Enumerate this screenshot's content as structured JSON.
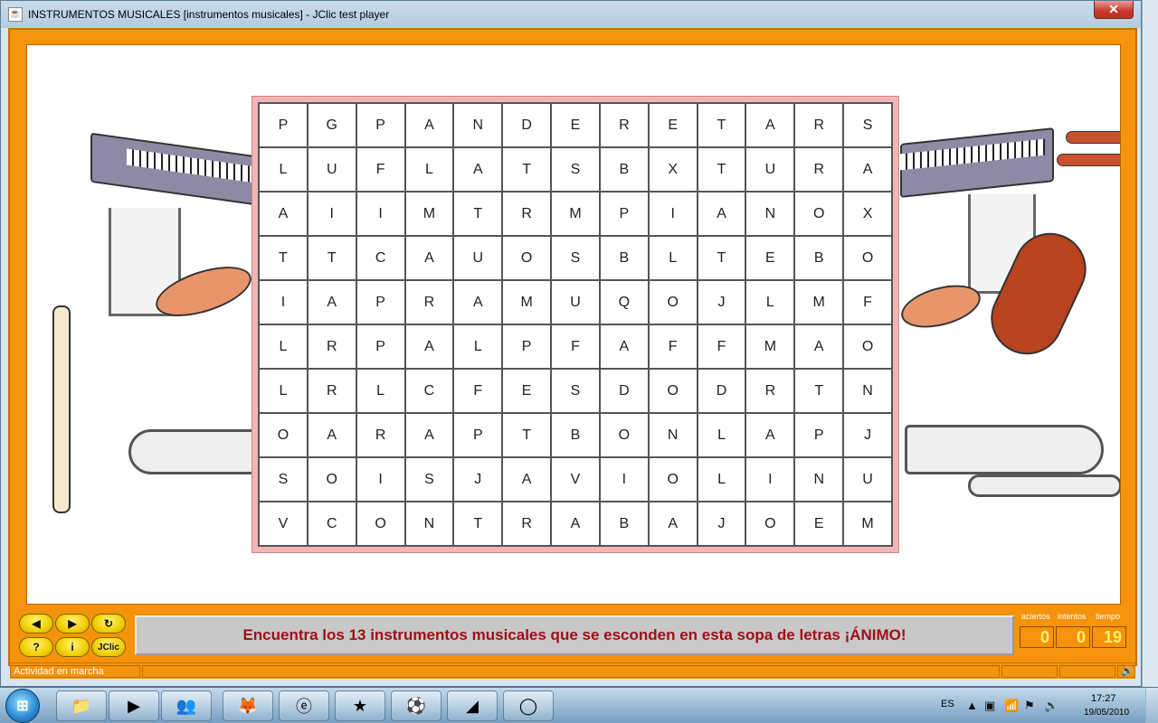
{
  "window": {
    "title": "INSTRUMENTOS MUSICALES [instrumentos musicales] - JClic test player",
    "close_label": "✕"
  },
  "grid": [
    [
      "P",
      "G",
      "P",
      "A",
      "N",
      "D",
      "E",
      "R",
      "E",
      "T",
      "A",
      "R",
      "S"
    ],
    [
      "L",
      "U",
      "F",
      "L",
      "A",
      "T",
      "S",
      "B",
      "X",
      "T",
      "U",
      "R",
      "A"
    ],
    [
      "A",
      "I",
      "I",
      "M",
      "T",
      "R",
      "M",
      "P",
      "I",
      "A",
      "N",
      "O",
      "X"
    ],
    [
      "T",
      "T",
      "C",
      "A",
      "U",
      "O",
      "S",
      "B",
      "L",
      "T",
      "E",
      "B",
      "O"
    ],
    [
      "I",
      "A",
      "P",
      "R",
      "A",
      "M",
      "U",
      "Q",
      "O",
      "J",
      "L",
      "M",
      "F"
    ],
    [
      "L",
      "R",
      "P",
      "A",
      "L",
      "P",
      "F",
      "A",
      "F",
      "F",
      "M",
      "A",
      "O"
    ],
    [
      "L",
      "R",
      "L",
      "C",
      "F",
      "E",
      "S",
      "D",
      "O",
      "D",
      "R",
      "T",
      "N"
    ],
    [
      "O",
      "A",
      "R",
      "A",
      "P",
      "T",
      "B",
      "O",
      "N",
      "L",
      "A",
      "P",
      "J"
    ],
    [
      "S",
      "O",
      "I",
      "S",
      "J",
      "A",
      "V",
      "I",
      "O",
      "L",
      "I",
      "N",
      "U"
    ],
    [
      "V",
      "C",
      "O",
      "N",
      "T",
      "R",
      "A",
      "B",
      "A",
      "J",
      "O",
      "E",
      "M"
    ]
  ],
  "controls": {
    "prev_icon": "◀",
    "next_icon": "▶",
    "restart_icon": "↻",
    "help_icon": "?",
    "info_icon": "i",
    "jclic_label": "JClic"
  },
  "message": "Encuentra los 13 instrumentos musicales que se esconden en esta sopa de letras ¡ÁNIMO!",
  "counters": {
    "aciertos_label": "aciertos",
    "intentos_label": "intentos",
    "tiempo_label": "tiempo",
    "aciertos": "0",
    "intentos": "0",
    "tiempo": "19"
  },
  "status": {
    "text": "Actividad en marcha"
  },
  "taskbar": {
    "language": "ES",
    "time": "17:27",
    "date": "19/05/2010"
  },
  "colors": {
    "frame": "#f5930c",
    "message_text": "#a10f16",
    "grid_border": "#f2b6b6"
  }
}
